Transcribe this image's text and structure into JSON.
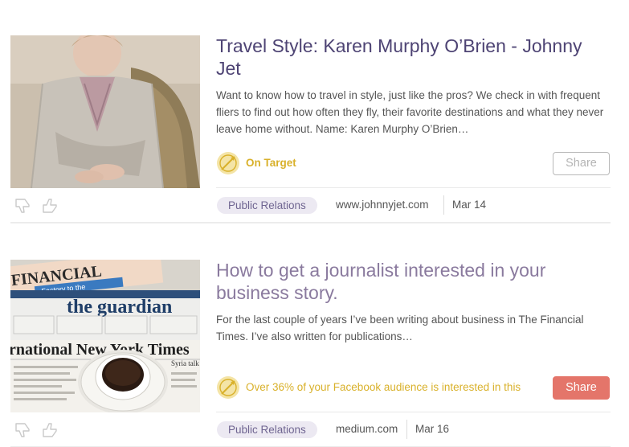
{
  "items": [
    {
      "title": "Travel Style: Karen Murphy O’Brien - Johnny Jet",
      "description": "Want to know how to travel in style, just like the pros? We check in with frequent fliers to find out how often they fly, their favorite destinations and what they never leave home without. Name: Karen Murphy O’Brien…",
      "target_text": "On Target",
      "share_label": "Share",
      "tag": "Public Relations",
      "source": "www.johnnyjet.com",
      "date": "Mar 14",
      "image": "woman-portrait-photo"
    },
    {
      "title": "How to get a journalist interested in your business story.",
      "description": "For the last couple of years I’ve been writing about business in The Financial Times. I’ve also written for publications…",
      "target_text": "Over 36% of your Facebook audience is interested in this",
      "share_label": "Share",
      "tag": "Public Relations",
      "source": "medium.com",
      "date": "Mar 16",
      "image": "newspapers-coffee-photo",
      "image_text": {
        "paper1": "FINANCIAL",
        "paper1_sub": "Factory to the",
        "paper2": "the guardian",
        "paper3": "rnational New York Times",
        "side": "Syria talk"
      }
    }
  ],
  "colors": {
    "accent_gold": "#d9b12b",
    "share_filled": "#e4756a",
    "tag_bg": "#ece9f2",
    "title_dark": "#4e4474"
  }
}
